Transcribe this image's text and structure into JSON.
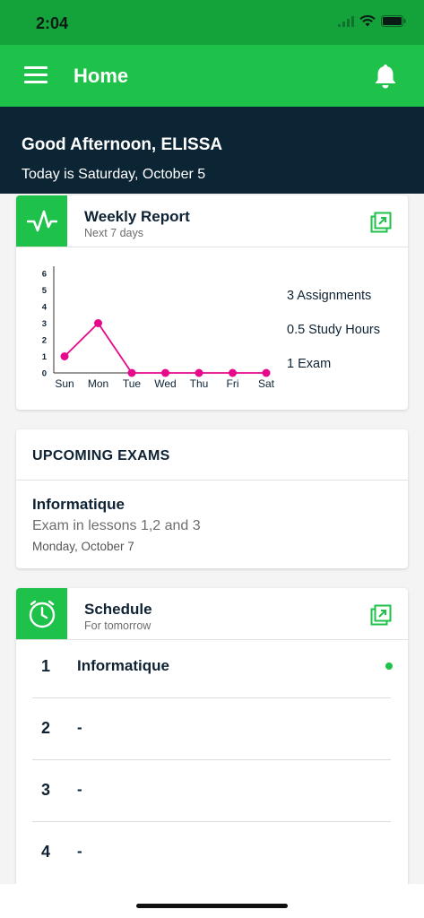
{
  "status_bar": {
    "time": "2:04"
  },
  "app_bar": {
    "title": "Home"
  },
  "greeting": {
    "title": "Good Afternoon, ELISSA",
    "subtitle": "Today is Saturday, October 5"
  },
  "weekly_report": {
    "title": "Weekly Report",
    "subtitle": "Next 7 days",
    "stats": [
      "3 Assignments",
      "0.5  Study Hours",
      "1 Exam"
    ]
  },
  "chart_data": {
    "type": "line",
    "categories": [
      "Sun",
      "Mon",
      "Tue",
      "Wed",
      "Thu",
      "Fri",
      "Sat"
    ],
    "values": [
      1,
      3,
      0,
      0,
      0,
      0,
      0
    ],
    "ylim": [
      0,
      6
    ],
    "yticks": [
      0,
      1,
      2,
      3,
      4,
      5,
      6
    ],
    "color": "#e6098c",
    "grid": false
  },
  "upcoming_exams": {
    "title": "UPCOMING EXAMS",
    "subject": "Informatique",
    "description": "Exam in lessons 1,2 and 3",
    "date": "Monday, October 7"
  },
  "schedule": {
    "title": "Schedule",
    "subtitle": "For tomorrow",
    "items": [
      {
        "num": "1",
        "subject": "Informatique"
      },
      {
        "num": "2",
        "subject": "-"
      },
      {
        "num": "3",
        "subject": "-"
      },
      {
        "num": "4",
        "subject": "-"
      }
    ]
  },
  "colors": {
    "accent_green": "#1ec24a",
    "status_green": "#14a23a",
    "navy": "#0c2535",
    "chart_line": "#e6098c"
  }
}
